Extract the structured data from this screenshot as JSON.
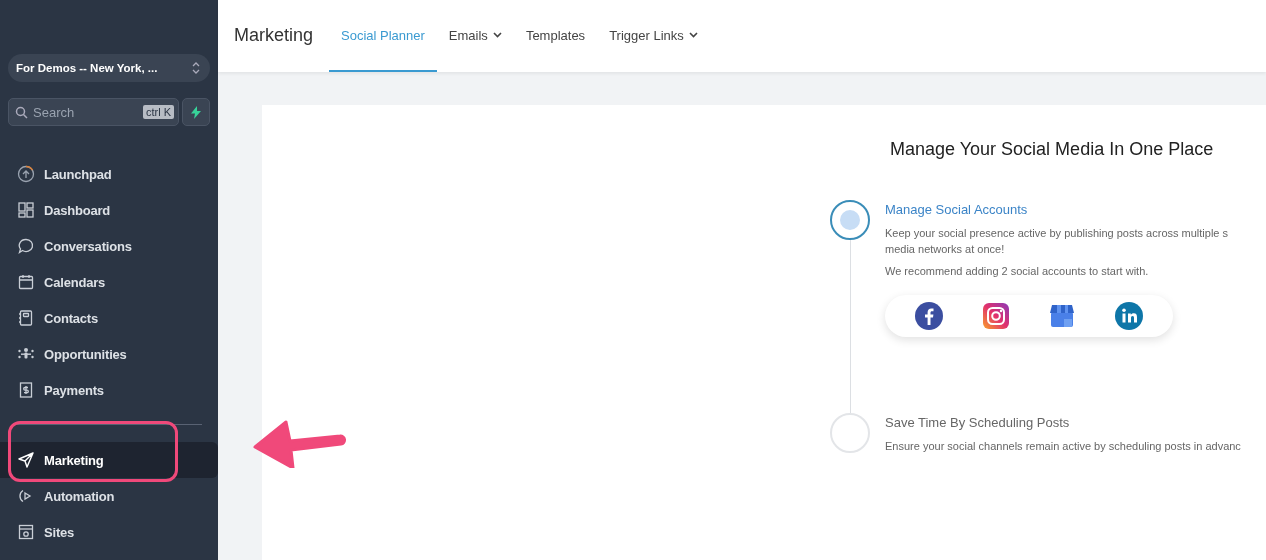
{
  "sidebar": {
    "account": "For Demos -- New York, ...",
    "search": {
      "placeholder": "Search",
      "shortcut": "ctrl K"
    },
    "items": [
      {
        "label": "Launchpad",
        "selected": false
      },
      {
        "label": "Dashboard",
        "selected": false
      },
      {
        "label": "Conversations",
        "selected": false
      },
      {
        "label": "Calendars",
        "selected": false
      },
      {
        "label": "Contacts",
        "selected": false
      },
      {
        "label": "Opportunities",
        "selected": false
      },
      {
        "label": "Payments",
        "selected": false
      },
      {
        "kind": "divider"
      },
      {
        "label": "Marketing",
        "selected": true
      },
      {
        "label": "Automation",
        "selected": false
      },
      {
        "label": "Sites",
        "selected": false
      }
    ]
  },
  "header": {
    "title": "Marketing",
    "tabs": [
      {
        "label": "Social Planner",
        "selected": true,
        "dropdown": false
      },
      {
        "label": "Emails",
        "selected": false,
        "dropdown": true
      },
      {
        "label": "Templates",
        "selected": false,
        "dropdown": false
      },
      {
        "label": "Trigger Links",
        "selected": false,
        "dropdown": true
      }
    ]
  },
  "content": {
    "title": "Manage Your Social Media In One Place",
    "steps": [
      {
        "title": "Manage Social Accounts",
        "active": true,
        "lines": [
          "Keep your social presence active by publishing posts across multiple s",
          "media networks at once!"
        ],
        "note": "We recommend adding 2 social accounts to start with.",
        "kind": "accounts"
      },
      {
        "title": "Save Time By Scheduling Posts",
        "active": false,
        "kind": "text",
        "lines": [
          "Ensure your social channels remain active by scheduling posts in advanc"
        ]
      }
    ]
  }
}
